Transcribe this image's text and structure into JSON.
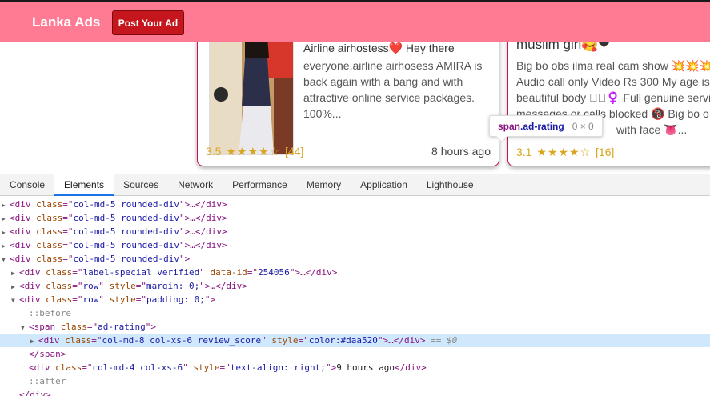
{
  "navbar": {
    "brand": "Lanka Ads",
    "post_button": "Post Your Ad",
    "bg_color": "#ff7a93",
    "button_color": "#c4161c"
  },
  "cards": [
    {
      "title": "Airline airhostess❤️ Hey there",
      "description": "everyone,airline airhosess AMIRA is back again with a bang and with attractive online service packages. 100%...",
      "rating_value": "3.5",
      "rating_stars": "★★★★☆",
      "rating_count": "[44]",
      "time": "8 hours ago"
    },
    {
      "title": "muslim girl🥰❤",
      "description_lines": [
        "Big bo obs ilma real cam show 💥💥💥",
        "Audio call only Video Rs 300 My age is",
        "beautiful body 🏻🏻♀️ Full genuine servic",
        "messages or calls blocked 🔞 Big bo o",
        "with face 👅..."
      ],
      "rating_value": "3.1",
      "rating_stars": "★★★★☆",
      "rating_count": "[16]"
    }
  ],
  "tooltip": {
    "tag": "span",
    "class": ".ad-rating",
    "dimensions": "0 × 0"
  },
  "devtools": {
    "tabs": [
      "Console",
      "Elements",
      "Sources",
      "Network",
      "Performance",
      "Memory",
      "Application",
      "Lighthouse"
    ],
    "active_tab": "Elements",
    "lines": [
      {
        "tri": "▶",
        "tag": "div",
        "attrs": [
          [
            "class",
            "col-md-5 rounded-div"
          ]
        ],
        "tail": "…</div>"
      },
      {
        "tri": "▶",
        "tag": "div",
        "attrs": [
          [
            "class",
            "col-md-5 rounded-div"
          ]
        ],
        "tail": "…</div>"
      },
      {
        "tri": "▶",
        "tag": "div",
        "attrs": [
          [
            "class",
            "col-md-5 rounded-div"
          ]
        ],
        "tail": "…</div>"
      },
      {
        "tri": "▶",
        "tag": "div",
        "attrs": [
          [
            "class",
            "col-md-5 rounded-div"
          ]
        ],
        "tail": "…</div>"
      },
      {
        "tri": "▼",
        "tag": "div",
        "attrs": [
          [
            "class",
            "col-md-5 rounded-div"
          ]
        ],
        "tail": ""
      },
      {
        "tri": "▶",
        "tag": "div",
        "attrs": [
          [
            "class",
            "label-special verified"
          ],
          [
            "data-id",
            "254056"
          ]
        ],
        "tail": "…</div>"
      },
      {
        "tri": "▶",
        "tag": "div",
        "attrs": [
          [
            "class",
            "row"
          ],
          [
            "style",
            "margin: 0;"
          ]
        ],
        "tail": "…</div>"
      },
      {
        "tri": "▼",
        "tag": "div",
        "attrs": [
          [
            "class",
            "row"
          ],
          [
            "style",
            "padding: 0;"
          ]
        ],
        "tail": ""
      },
      {
        "tri": "",
        "pseudo": "::before"
      },
      {
        "tri": "▼",
        "tag": "span",
        "attrs": [
          [
            "class",
            "ad-rating"
          ]
        ],
        "tail": ""
      },
      {
        "tri": "▶",
        "tag": "div",
        "attrs": [
          [
            "class",
            "col-md-8 col-xs-6 review_score"
          ],
          [
            "style",
            "color:#daa520"
          ]
        ],
        "tail": "…</div>",
        "suffix": " == $0"
      },
      {
        "tri": "",
        "close": "</span>"
      },
      {
        "tri": "",
        "tag": "div",
        "attrs": [
          [
            "class",
            "col-md-4 col-xs-6"
          ],
          [
            "style",
            "text-align: right;"
          ]
        ],
        "inner": "9 hours ago",
        "tail": "</div>"
      },
      {
        "tri": "",
        "pseudo": "::after"
      },
      {
        "tri": "",
        "close": "</div>"
      }
    ]
  }
}
